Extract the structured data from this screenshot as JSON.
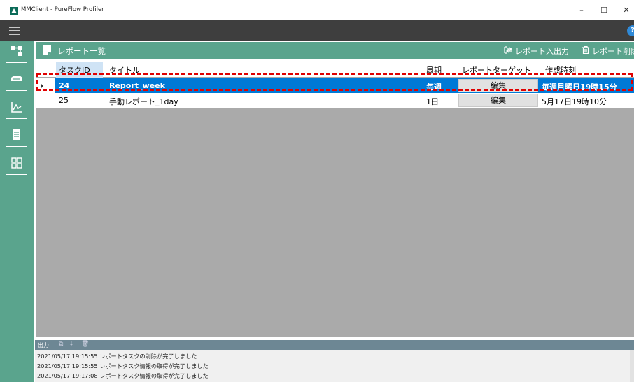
{
  "window": {
    "title": "MMClient - PureFlow Profiler",
    "minimize": "–",
    "maximize": "☐",
    "close": "✕"
  },
  "menubar": {
    "help": "?"
  },
  "sidebar": {
    "items": [
      {
        "icon": "network-topology-icon"
      },
      {
        "icon": "device-icon"
      },
      {
        "icon": "chart-line-icon"
      },
      {
        "icon": "report-document-icon"
      },
      {
        "icon": "grid-layout-icon"
      }
    ]
  },
  "header": {
    "title": "レポート一覧",
    "io_label": "レポート入出力",
    "delete_label": "レポート削除"
  },
  "table": {
    "columns": [
      "タスクID",
      "タイトル",
      "周期",
      "レポートターゲット",
      "作成時刻"
    ],
    "rows": [
      {
        "id": "24",
        "title": "Report_week",
        "period": "毎週",
        "target": "編集",
        "created": "毎週月曜日19時15分",
        "selected": true
      },
      {
        "id": "25",
        "title": "手動レポート_1day",
        "period": "1日",
        "target": "編集",
        "created": "5月17日19時10分",
        "selected": false
      }
    ]
  },
  "output": {
    "label": "出力",
    "lines": [
      "2021/05/17 19:15:55 レポートタスクの削除が完了しました",
      "2021/05/17 19:15:55 レポートタスク情報の取得が完了しました",
      "2021/05/17 19:17:08 レポートタスク情報の取得が完了しました"
    ]
  },
  "colors": {
    "accent_green": "#5aa48d",
    "selection_blue": "#0079d6",
    "highlight_dashed": "#e00000"
  }
}
